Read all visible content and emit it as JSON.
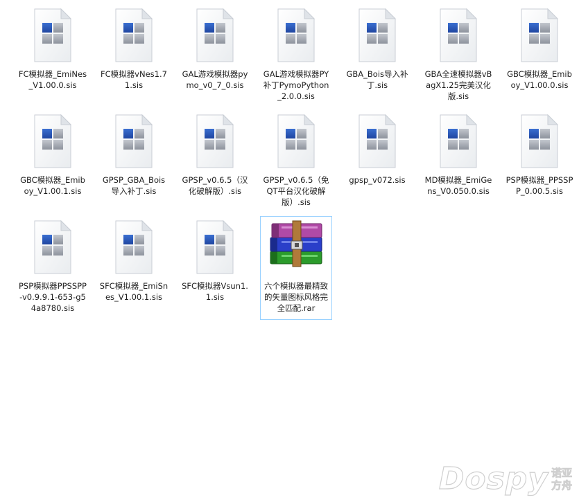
{
  "files": [
    {
      "label": "FC模拟器_EmiNes_V1.00.0.sis",
      "icon": "sis-file-icon"
    },
    {
      "label": "FC模拟器vNes1.71.sis",
      "icon": "sis-file-icon"
    },
    {
      "label": "GAL游戏模拟器pymo_v0_7_0.sis",
      "icon": "sis-file-icon"
    },
    {
      "label": "GAL游戏模拟器PY补丁PymoPython_2.0.0.sis",
      "icon": "sis-file-icon"
    },
    {
      "label": "GBA_Bois导入补丁.sis",
      "icon": "sis-file-icon"
    },
    {
      "label": "GBA全速模拟器vBagX1.25完美汉化版.sis",
      "icon": "sis-file-icon"
    },
    {
      "label": "GBC模拟器_Emiboy_V1.00.0.sis",
      "icon": "sis-file-icon"
    },
    {
      "label": "GBC模拟器_Emiboy_V1.00.1.sis",
      "icon": "sis-file-icon"
    },
    {
      "label": "GPSP_GBA_Bois导入补丁.sis",
      "icon": "sis-file-icon"
    },
    {
      "label": "GPSP_v0.6.5（汉化破解版）.sis",
      "icon": "sis-file-icon"
    },
    {
      "label": "GPSP_v0.6.5（免QT平台汉化破解版）.sis",
      "icon": "sis-file-icon"
    },
    {
      "label": "gpsp_v072.sis",
      "icon": "sis-file-icon"
    },
    {
      "label": "MD模拟器_EmiGens_V0.050.0.sis",
      "icon": "sis-file-icon"
    },
    {
      "label": "PSP模拟器_PPSSPP_0.00.5.sis",
      "icon": "sis-file-icon"
    },
    {
      "label": "PSP模拟器PPSSPP-v0.9.9.1-653-g54a8780.sis",
      "icon": "sis-file-icon"
    },
    {
      "label": "SFC模拟器_EmiSnes_V1.00.1.sis",
      "icon": "sis-file-icon"
    },
    {
      "label": "SFC模拟器Vsun1.1.sis",
      "icon": "sis-file-icon"
    },
    {
      "label": "六个模拟器最精致的矢量图标风格完全匹配.rar",
      "icon": "winrar-archive-icon",
      "selected": true
    }
  ],
  "watermark": {
    "text": "Dospy",
    "cn_line1": "诺亚",
    "cn_line2": "方舟"
  },
  "colors": {
    "selection_border": "#99d1ff",
    "icon_blue": "#2a56b8",
    "icon_gray": "#a9aeb8"
  }
}
